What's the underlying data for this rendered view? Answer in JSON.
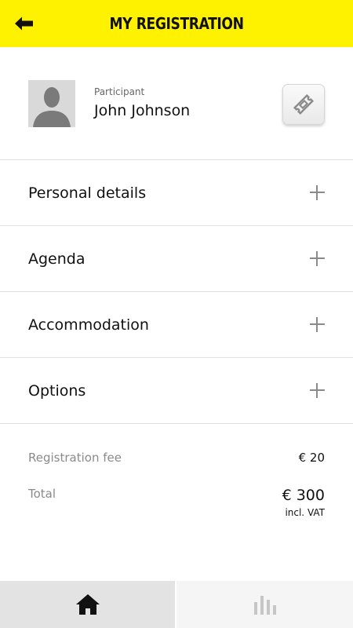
{
  "header": {
    "title": "MY REGISTRATION",
    "back_icon": "arrow-left-icon",
    "background_color": "#fff200"
  },
  "participant": {
    "label": "Participant",
    "name": "John Johnson",
    "avatar_icon": "person-silhouette-icon",
    "action_icon": "ticket-icon"
  },
  "sections": [
    {
      "label": "Personal details",
      "icon": "plus-icon"
    },
    {
      "label": "Agenda",
      "icon": "plus-icon"
    },
    {
      "label": "Accommodation",
      "icon": "plus-icon"
    },
    {
      "label": "Options",
      "icon": "plus-icon"
    }
  ],
  "fees": {
    "registration_label": "Registration fee",
    "registration_value": "€ 20",
    "total_label": "Total",
    "total_value": "€ 300",
    "total_note": "incl. VAT"
  },
  "bottom_nav": {
    "tabs": [
      {
        "icon": "home-icon",
        "selected": true
      },
      {
        "icon": "bar-chart-icon",
        "selected": false
      }
    ]
  }
}
